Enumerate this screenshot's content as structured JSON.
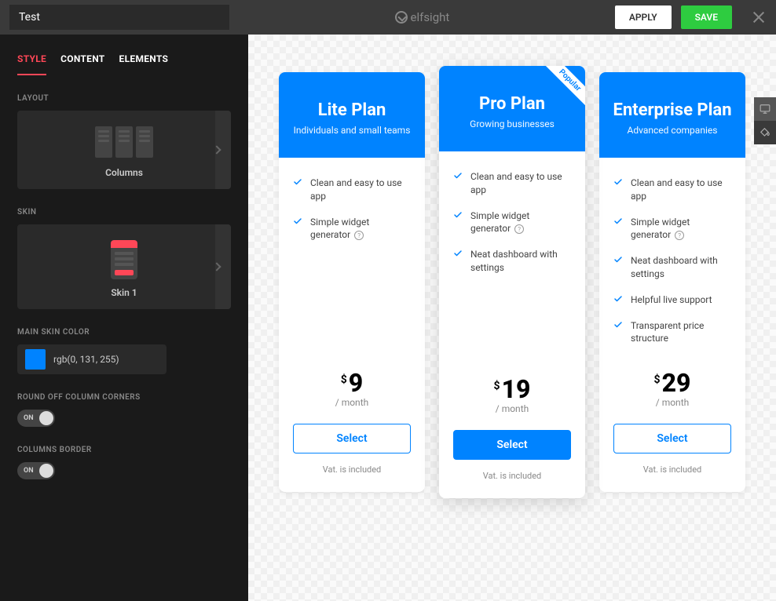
{
  "header": {
    "title_value": "Test",
    "brand": "elfsight",
    "apply_label": "APPLY",
    "save_label": "SAVE"
  },
  "sidebar": {
    "tabs": {
      "style": "STYLE",
      "content": "CONTENT",
      "elements": "ELEMENTS"
    },
    "layout_label": "LAYOUT",
    "layout_value": "Columns",
    "skin_label": "SKIN",
    "skin_value": "Skin 1",
    "main_color_label": "MAIN SKIN COLOR",
    "main_color_value": "rgb(0, 131, 255)",
    "main_color_hex": "#0083ff",
    "round_label": "ROUND OFF COLUMN CORNERS",
    "round_state": "ON",
    "border_label": "COLUMNS BORDER",
    "border_state": "ON"
  },
  "plans": [
    {
      "title": "Lite Plan",
      "subtitle": "Individuals and small teams",
      "featured": false,
      "ribbon": "",
      "features": [
        {
          "text": "Clean and easy to use app",
          "info": false
        },
        {
          "text": "Simple widget generator",
          "info": true
        }
      ],
      "currency": "$",
      "amount": "9",
      "period": "/ month",
      "button": "Select",
      "foot": "Vat. is included"
    },
    {
      "title": "Pro Plan",
      "subtitle": "Growing businesses",
      "featured": true,
      "ribbon": "Popular",
      "features": [
        {
          "text": "Clean and easy to use app",
          "info": false
        },
        {
          "text": "Simple widget generator",
          "info": true
        },
        {
          "text": "Neat dashboard with settings",
          "info": false
        }
      ],
      "currency": "$",
      "amount": "19",
      "period": "/ month",
      "button": "Select",
      "foot": "Vat. is included"
    },
    {
      "title": "Enterprise Plan",
      "subtitle": "Advanced companies",
      "featured": false,
      "ribbon": "",
      "features": [
        {
          "text": "Clean and easy to use app",
          "info": false
        },
        {
          "text": "Simple widget generator",
          "info": true
        },
        {
          "text": "Neat dashboard with settings",
          "info": false
        },
        {
          "text": "Helpful live support",
          "info": false
        },
        {
          "text": "Transparent price structure",
          "info": false
        }
      ],
      "currency": "$",
      "amount": "29",
      "period": "/ month",
      "button": "Select",
      "foot": "Vat. is included"
    }
  ]
}
